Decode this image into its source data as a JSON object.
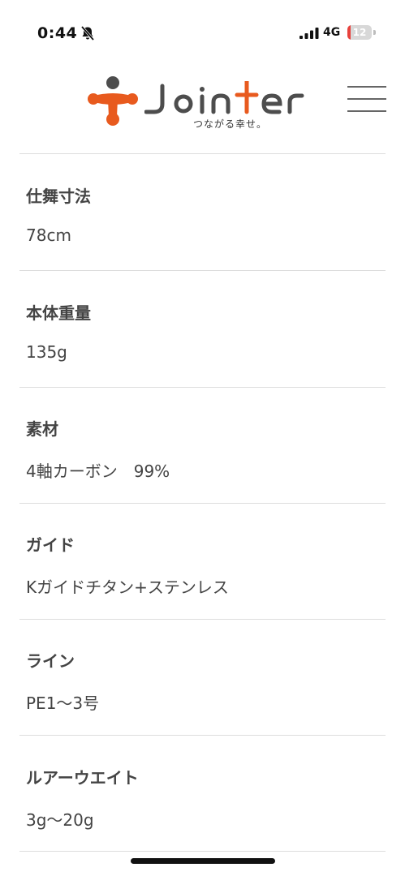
{
  "status_bar": {
    "time": "0:44",
    "network": "4G",
    "battery_level": "12",
    "battery_fraction": 0.12,
    "icons": [
      "mute-icon",
      "signal-icon",
      "battery-icon"
    ]
  },
  "header": {
    "logo_text": "Jointer",
    "tagline": "つながる幸せ。",
    "brand_colors": {
      "orange": "#E85A1E",
      "gray": "#4D4D4D"
    },
    "menu_icon": "hamburger-menu-icon"
  },
  "specs": [
    {
      "label": "仕舞寸法",
      "value": "78cm"
    },
    {
      "label": "本体重量",
      "value": "135g"
    },
    {
      "label": "素材",
      "value": "4軸カーボン　99%"
    },
    {
      "label": "ガイド",
      "value": "Kガイドチタン+ステンレス"
    },
    {
      "label": "ライン",
      "value": "PE1〜3号"
    },
    {
      "label": "ルアーウエイト",
      "value": "3g〜20g"
    }
  ]
}
